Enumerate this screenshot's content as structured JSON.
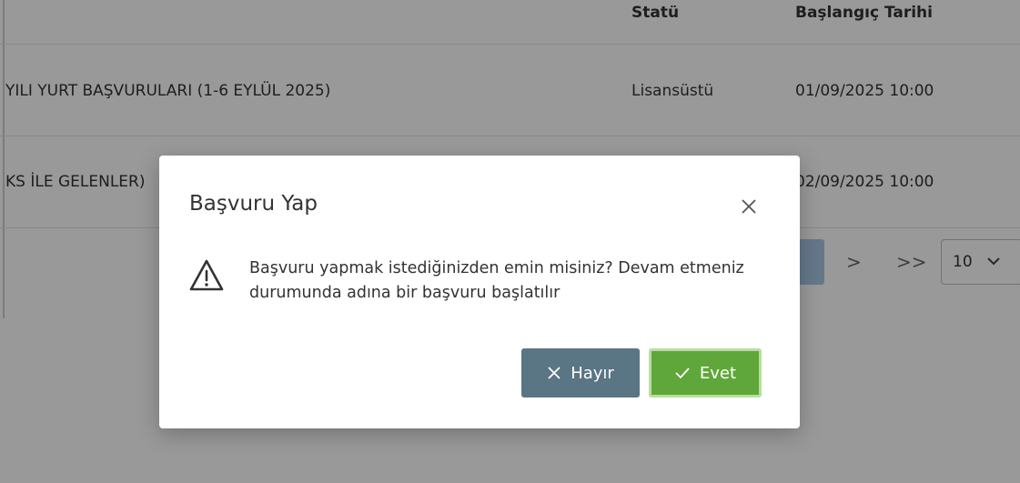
{
  "table": {
    "headers": {
      "statu": "Statü",
      "baslangic": "Başlangıç Tarihi"
    },
    "rows": [
      {
        "name": "YILI YURT BAŞVURULARI (1-6 EYLÜL 2025)",
        "statu": "Lisansüstü",
        "date": "01/09/2025 10:00"
      },
      {
        "name": "KS İLE GELENLER)",
        "statu": "",
        "date": "02/09/2025 10:00"
      }
    ]
  },
  "pagination": {
    "next": ">",
    "last": ">>",
    "page_size": "10"
  },
  "dialog": {
    "title": "Başvuru Yap",
    "message": "Başvuru yapmak istediğinizden emin misiniz? Devam etmeniz durumunda adına bir başvuru başlatılır",
    "no_label": "Hayır",
    "yes_label": "Evet",
    "icons": {
      "close": "close-icon",
      "warning": "warning-icon",
      "no": "times-icon",
      "yes": "check-icon"
    }
  },
  "colors": {
    "no_button": "#5a7583",
    "yes_button": "#5fa73a",
    "pager_active": "#a9c8e6",
    "overlay": "rgba(0,0,0,0.40)"
  }
}
